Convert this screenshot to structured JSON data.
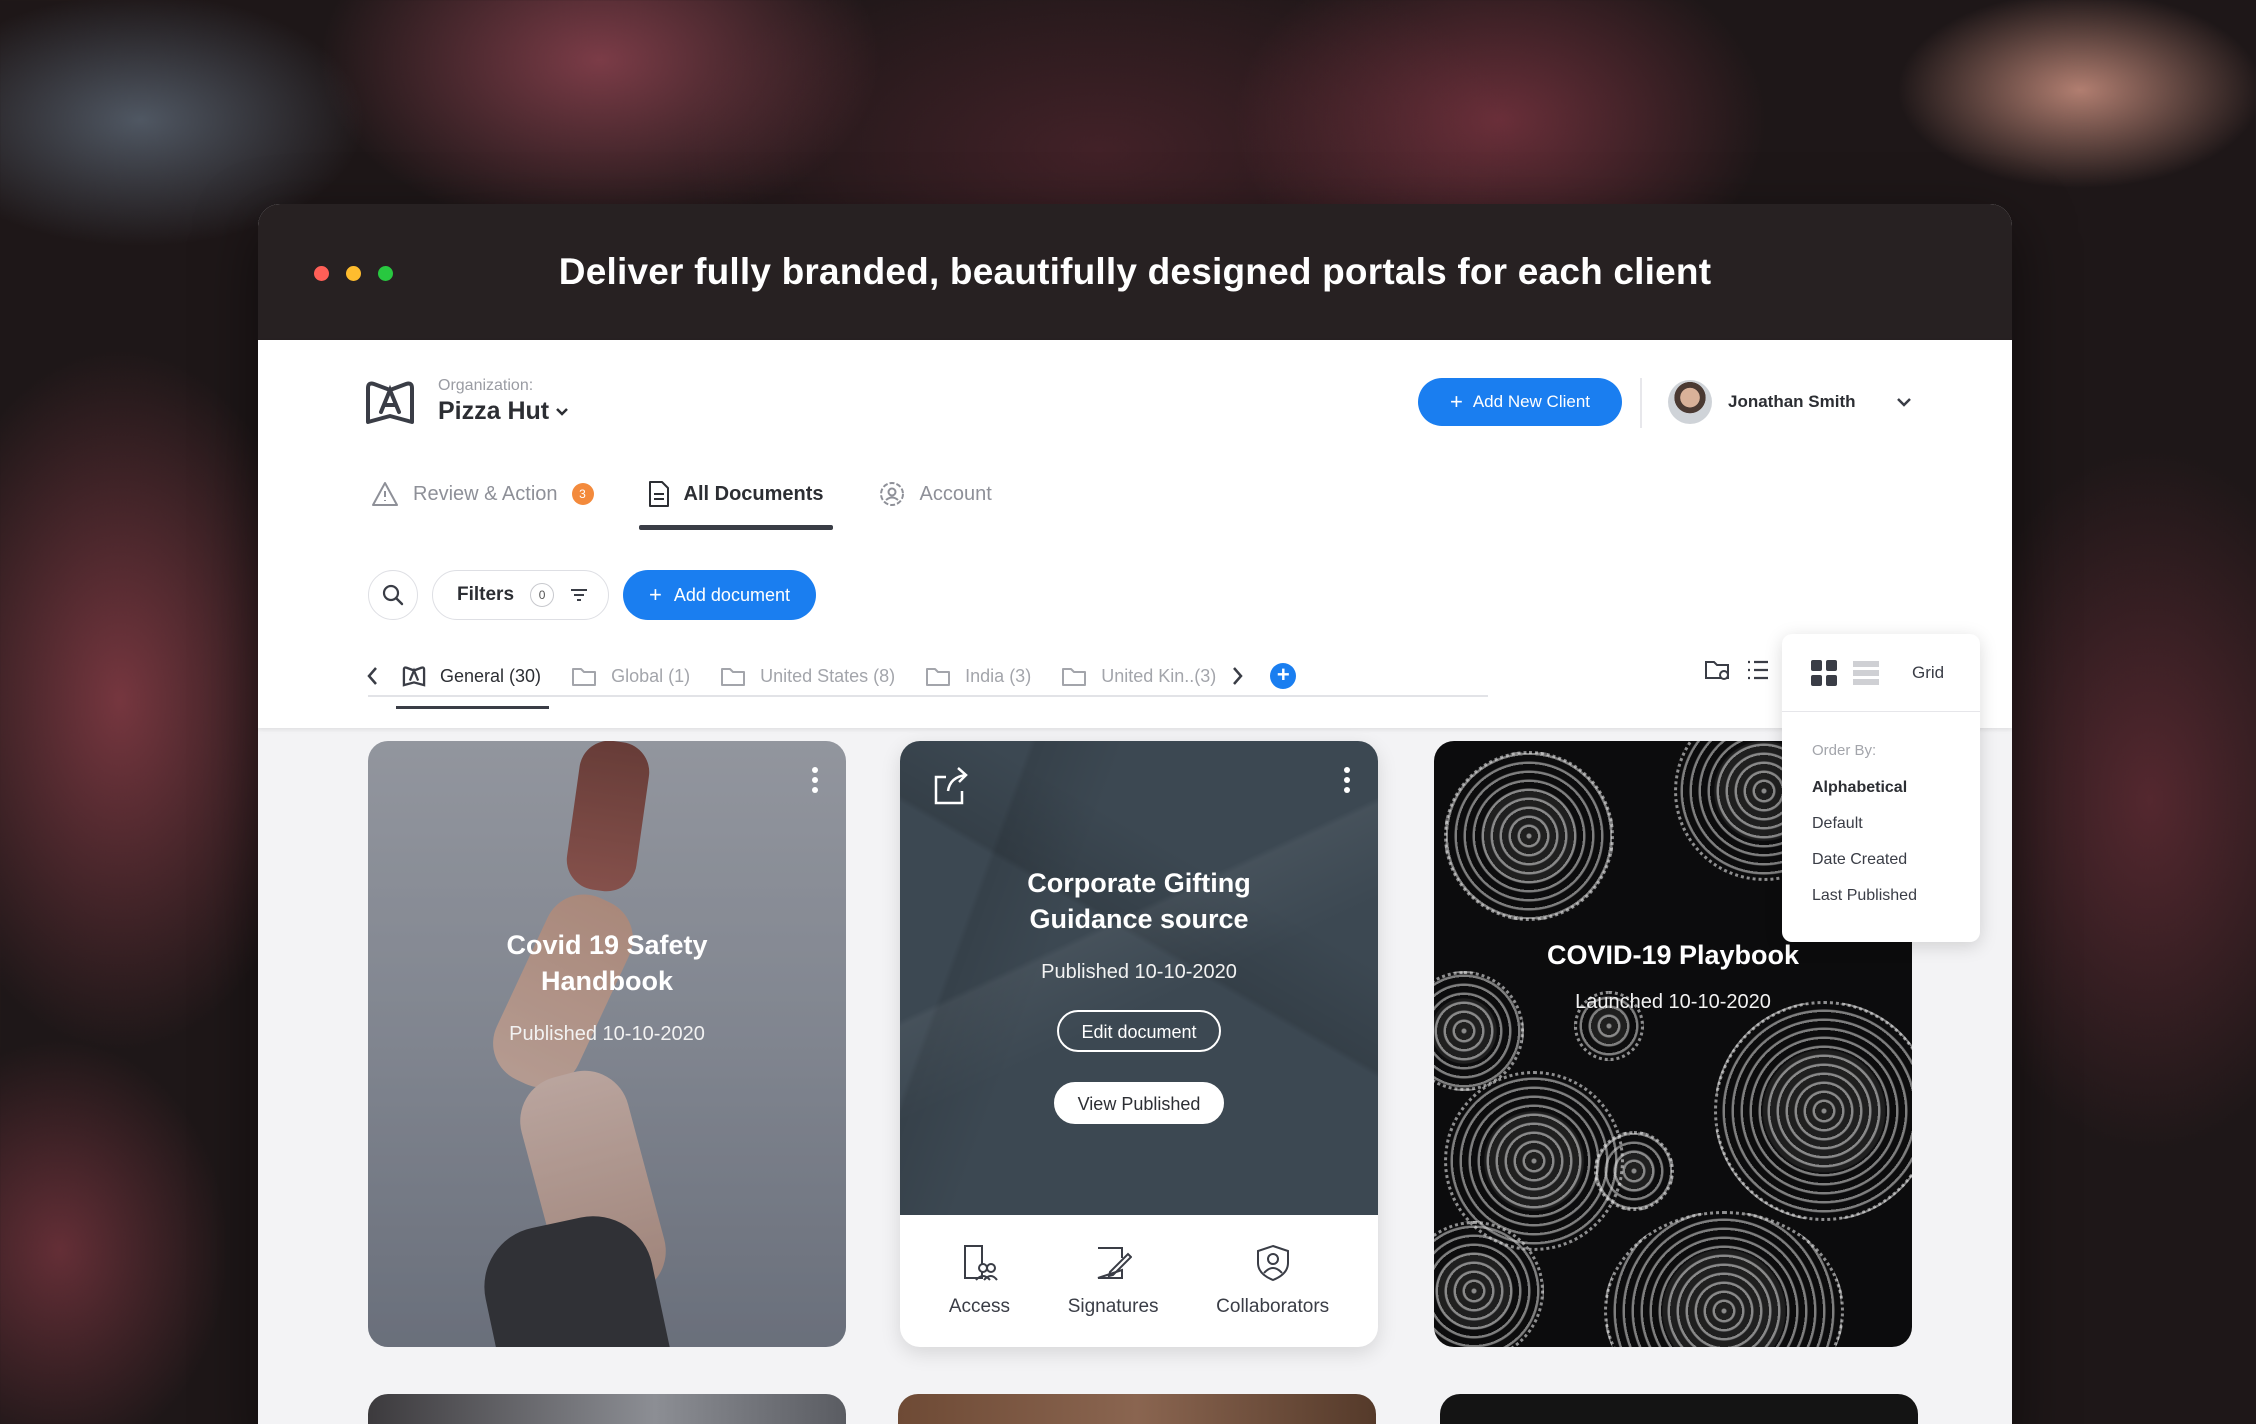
{
  "banner": {
    "title": "Deliver fully branded, beautifully designed portals for each client"
  },
  "header": {
    "org_label": "Organization:",
    "org_name": "Pizza Hut",
    "add_client_label": "Add New Client",
    "user_name": "Jonathan Smith"
  },
  "tabs": [
    {
      "label": "Review & Action",
      "badge": "3"
    },
    {
      "label": "All Documents"
    },
    {
      "label": "Account"
    }
  ],
  "toolbar": {
    "filters_label": "Filters",
    "filters_count": "0",
    "add_document_label": "Add document"
  },
  "folders": [
    {
      "label": "General (30)"
    },
    {
      "label": "Global (1)"
    },
    {
      "label": "United States (8)"
    },
    {
      "label": "India (3)"
    },
    {
      "label": "United Kin..(3)"
    }
  ],
  "view_menu": {
    "mode_label": "Grid",
    "order_by_label": "Order By:",
    "options": [
      "Alphabetical",
      "Default",
      "Date Created",
      "Last Published"
    ],
    "selected": "Alphabetical"
  },
  "cards": [
    {
      "title_line1": "Covid 19 Safety",
      "title_line2": "Handbook",
      "date": "Published 10-10-2020"
    },
    {
      "title_line1": "Corporate Gifting",
      "title_line2": "Guidance source",
      "date": "Published 10-10-2020",
      "edit_label": "Edit document",
      "view_label": "View Published",
      "actions": [
        "Access",
        "Signatures",
        "Collaborators"
      ]
    },
    {
      "title_line1": "COVID-19 Playbook",
      "date": "Launched 10-10-2020"
    }
  ],
  "colors": {
    "accent": "#1a7ef0",
    "badge": "#f38a3c",
    "titlebar": "#272122",
    "dot_red": "#ff5f57",
    "dot_yellow": "#febc2e",
    "dot_green": "#28c840"
  }
}
